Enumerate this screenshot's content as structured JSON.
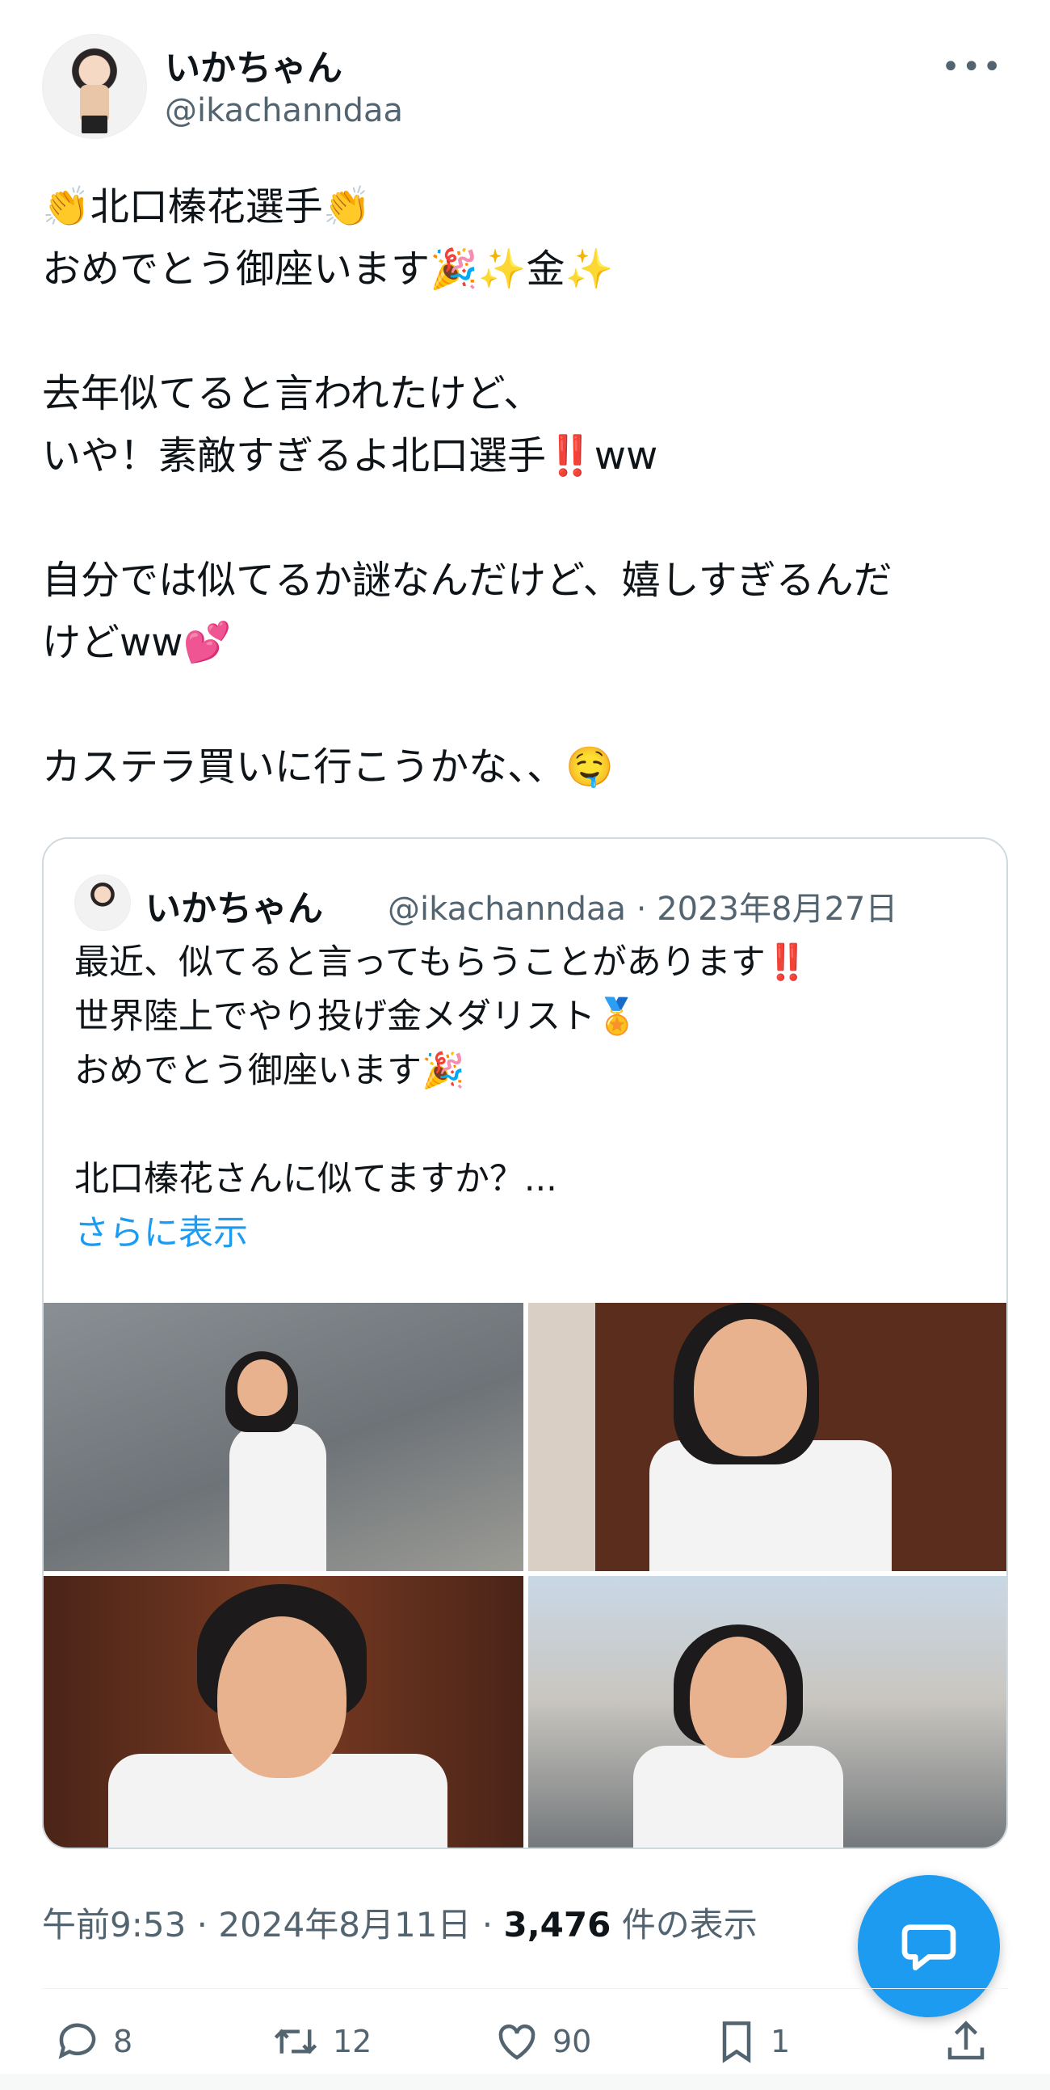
{
  "author": {
    "name": "いかちゃん",
    "handle": "@ikachanndaa",
    "more_icon": "more-horizontal-icon"
  },
  "tweet_lines": [
    "👏北口榛花選手👏",
    "おめでとう御座います🎉✨金✨",
    "",
    "去年似てると言われたけど、",
    "いや！素敵すぎるよ北口選手‼️ww",
    "",
    "自分では似てるか謎なんだけど、嬉しすぎるんだ",
    "けどww💕",
    "",
    "カステラ買いに行こうかな、、🤤"
  ],
  "quote": {
    "name": "いかちゃん",
    "handle_date": "@ikachanndaa · 2023年8月27日",
    "lines": [
      "最近、似てると言ってもらうことがあります‼️",
      "世界陸上でやり投げ金メダリスト🏅",
      "おめでとう御座います🎉",
      "",
      "北口榛花さんに似てますか？..."
    ],
    "show_more": "さらに表示"
  },
  "meta": {
    "time_date": "午前9:53 · 2024年8月11日 · ",
    "views_count": "3,476",
    "views_label": " 件の表示"
  },
  "actions": {
    "replies": "8",
    "retweets": "12",
    "likes": "90",
    "bookmarks": "1"
  },
  "colors": {
    "accent": "#1d9bf0",
    "secondary_text": "#536471",
    "border": "#cfd9de"
  }
}
